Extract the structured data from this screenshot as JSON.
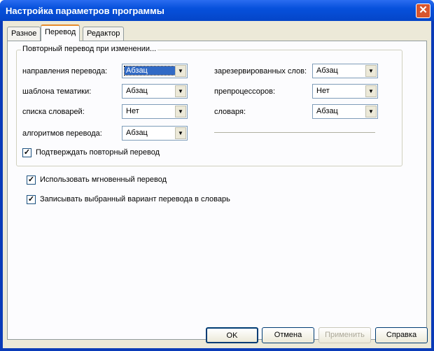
{
  "title": "Настройка параметров программы",
  "tabs": [
    "Разное",
    "Перевод",
    "Редактор"
  ],
  "group": {
    "label": "Повторный перевод при изменении...",
    "left": [
      {
        "label": "направления перевода:",
        "value": "Абзац"
      },
      {
        "label": "шаблона тематики:",
        "value": "Абзац"
      },
      {
        "label": "списка словарей:",
        "value": "Нет"
      },
      {
        "label": "алгоритмов перевода:",
        "value": "Абзац"
      }
    ],
    "right": [
      {
        "label": "зарезервированных слов:",
        "value": "Абзац"
      },
      {
        "label": "препроцессоров:",
        "value": "Нет"
      },
      {
        "label": "словаря:",
        "value": "Абзац"
      }
    ],
    "confirm": "Подтверждать повторный перевод"
  },
  "instant": "Использовать мгновенный перевод",
  "save_variant": "Записывать выбранный вариант перевода в словарь",
  "buttons": {
    "ok": "OK",
    "cancel": "Отмена",
    "apply": "Применить",
    "help": "Справка"
  }
}
